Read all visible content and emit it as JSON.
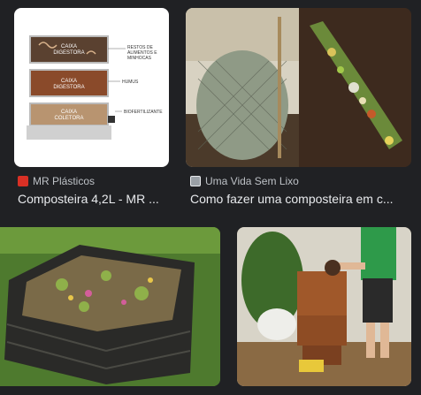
{
  "results": [
    {
      "source": "MR Plásticos",
      "title": "Composteira 4,2L - MR ...",
      "favicon": "mr-plasticos-favicon-icon",
      "diagram": {
        "box1": "CAIXA\nDIGESTORA",
        "box2": "CAIXA\nDIGESTORA",
        "box3": "CAIXA\nCOLETORA",
        "label_restos": "RESTOS DE\nALIMENTOS E\nMINHOCAS",
        "label_humus": "HUMUS",
        "label_bio": "BIOFERTILIZANTE"
      }
    },
    {
      "source": "Uma Vida Sem Lixo",
      "title": "Como fazer uma composteira em c...",
      "favicon": "uma-vida-sem-lixo-favicon-icon"
    },
    {
      "image": "wooden-compost-bin-photo"
    },
    {
      "image": "stacked-compost-bins-photo"
    }
  ],
  "colors": {
    "background": "#202124",
    "title": "#e8eaed",
    "source": "#bdc1c6"
  }
}
